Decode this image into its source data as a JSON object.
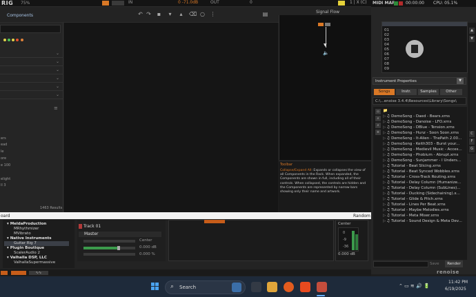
{
  "topbar": {
    "logo": "RIG",
    "volume_field": "75%",
    "in_label": "IN",
    "in_level": "0 -71.0dB",
    "out_label": "OUT",
    "out_level": "0",
    "top_right": "1 | X (C)",
    "midi_map": "MIDI MAP",
    "clock": "00:00:00",
    "cpu": "CPU: 05.1%"
  },
  "toolbar": {
    "components_label": "Components",
    "signal_flow_title": "Signal Flow"
  },
  "left_panel": {
    "results": "1463 Results",
    "fragments": [
      "ers",
      "ead",
      "le",
      "ore",
      "e 100",
      "",
      "elight",
      "ll 3"
    ]
  },
  "help": {
    "title": "Toolbar",
    "highlight": "Collapse/Expand All",
    "text": ": Expands or collapses the view of all Components in the Rack. When expanded, the Components are shown in full, including all of their controls. When collapsed, the controls are hidden and the Components are represented by narrow bars showing only their name and artwork."
  },
  "keyboard_bar": {
    "label": "oard",
    "random": "Random"
  },
  "plugins": [
    {
      "name": "MeldaProduction",
      "vendor": true
    },
    {
      "name": "MRhythmizer",
      "vendor": false
    },
    {
      "name": "MVibrato",
      "vendor": false
    },
    {
      "name": "Native Instruments",
      "vendor": true
    },
    {
      "name": "Guitar Rig 7",
      "vendor": false
    },
    {
      "name": "Plugin Boutique",
      "vendor": true
    },
    {
      "name": "ScalerAudio 2",
      "vendor": false
    },
    {
      "name": "Valhalla DSP, LLC",
      "vendor": true
    },
    {
      "name": "ValhallaSupermassive",
      "vendor": false
    }
  ],
  "track": {
    "name": "Track 01",
    "routing": "Master",
    "pan_label": "Center",
    "volume": "0.000 dB",
    "width": "0.000 %",
    "volume_fill": 0.68,
    "pan_fill": 0.45
  },
  "meter": {
    "center": "Center",
    "marks": [
      "0",
      "-9",
      "-36"
    ],
    "value": "0.000 dB"
  },
  "renoise": {
    "instrument_slots": [
      "00",
      "01",
      "02",
      "03",
      "04",
      "05",
      "06",
      "07",
      "08",
      "09"
    ],
    "instrument_properties": "Instrument Properties",
    "tabs": [
      "Songs",
      "Instr.",
      "Samples",
      "Other"
    ],
    "active_tab": "Songs",
    "path": "C:\\...enoise 3.4.4\\Resources\\Library\\Songs\\",
    "side_buttons": [
      "C",
      "F",
      "G"
    ],
    "files": [
      "DemoSong - Daed - Bears.xrns",
      "DemoSong - Danoise - LFO.xrns",
      "DemoSong - DBlue - Tension.xrns",
      "DemoSong - Hunz - Soon Soon.xrns",
      "DemoSong - It-Alien - ThePath 2.00...",
      "DemoSong - Keith303 - Burst your...",
      "DemoSong - Medievil Music - Acces...",
      "DemoSong - Phobium - Abrupt.xrns",
      "DemoSong - Sunjammer - I Unders...",
      "Tutorial - Beat Slicing.xrns",
      "Tutorial - Beat Synced Wobbles.xrns",
      "Tutorial - Cross-Track Routing.xrns",
      "Tutorial - Delay Column (Humanize...",
      "Tutorial - Delay Column (SubLines)...",
      "Tutorial - Ducking (Sidechaining).x...",
      "Tutorial - Glide & Pitch.xrns",
      "Tutorial - Lines Per Beat.xrns",
      "Tutorial - Maybe Melodies.xrns",
      "Tutorial - Meta Mixer.xrns",
      "Tutorial - Sound Design & Meta Dev..."
    ],
    "save_label": "Save",
    "render_label": "Render",
    "brand": "renoise"
  },
  "taskbar": {
    "search_placeholder": "Search",
    "time": "11:42 PM",
    "date": "6/19/2025",
    "apps": [
      "file-explorer-icon",
      "firefox-icon",
      "brave-icon",
      "notion-icon",
      "guitar-rig-icon"
    ]
  },
  "colors": {
    "accent": "#d97826",
    "meter_green": "#3c9a4c",
    "background": "#1e1e1e"
  }
}
